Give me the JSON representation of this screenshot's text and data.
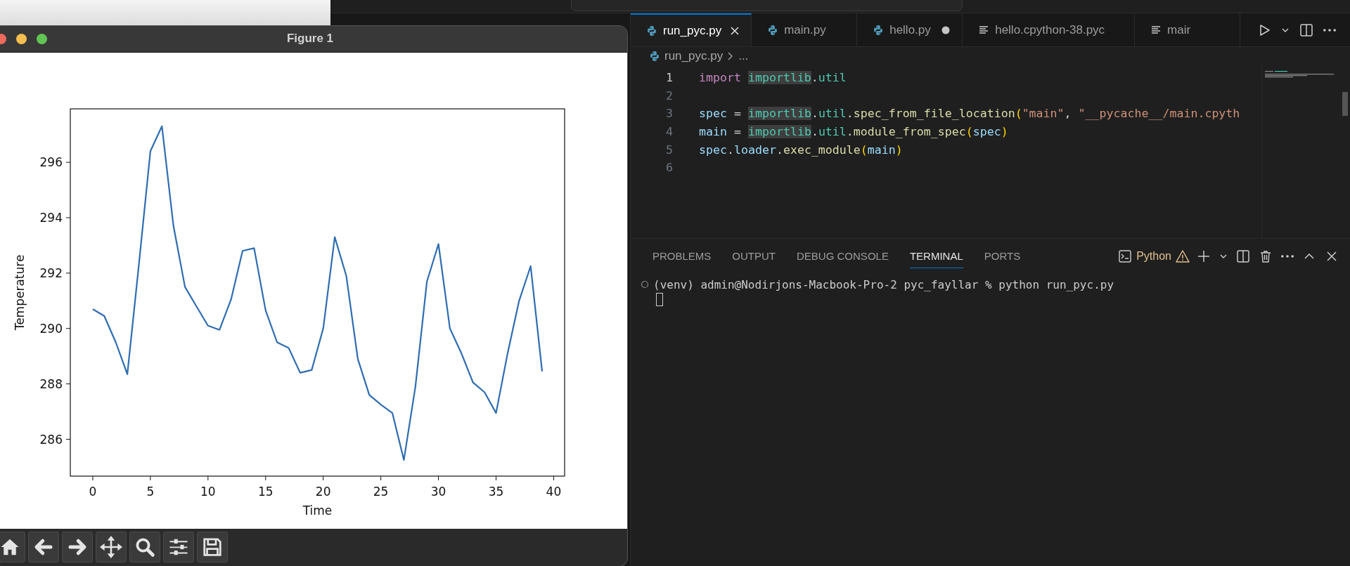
{
  "figure_window": {
    "title": "Figure 1",
    "chart_data": {
      "type": "line",
      "xlabel": "Time",
      "ylabel": "Temperature",
      "x": [
        0,
        1,
        2,
        3,
        4,
        5,
        6,
        7,
        8,
        9,
        10,
        11,
        12,
        13,
        14,
        15,
        16,
        17,
        18,
        19,
        20,
        21,
        22,
        23,
        24,
        25,
        26,
        27,
        28,
        29,
        30,
        31,
        32,
        33,
        34,
        35,
        36,
        37,
        38,
        39
      ],
      "series": [
        {
          "color": "#2f6db0",
          "values": [
            290.7,
            290.45,
            289.5,
            288.35,
            292.3,
            296.4,
            297.3,
            293.7,
            291.5,
            290.8,
            290.1,
            289.95,
            291.05,
            292.8,
            292.9,
            290.65,
            289.5,
            289.3,
            288.4,
            288.5,
            290.0,
            293.3,
            291.9,
            288.9,
            287.6,
            287.25,
            286.95,
            285.25,
            287.9,
            291.7,
            293.05,
            290.0,
            289.1,
            288.05,
            287.7,
            286.95,
            289.1,
            291.0,
            292.25,
            288.45
          ]
        }
      ],
      "xlim": [
        -1.95,
        40.95
      ],
      "ylim": [
        284.67,
        297.93
      ],
      "xticks": [
        0,
        5,
        10,
        15,
        20,
        25,
        30,
        35,
        40
      ],
      "yticks": [
        286,
        288,
        290,
        292,
        294,
        296
      ]
    }
  },
  "editor": {
    "tabs": [
      {
        "label": "run_pyc.py",
        "kind": "python",
        "selected": true,
        "modified": false
      },
      {
        "label": "main.py",
        "kind": "python",
        "selected": false,
        "modified": false
      },
      {
        "label": "hello.py",
        "kind": "python",
        "selected": false,
        "modified": true
      },
      {
        "label": "hello.cpython-38.pyc",
        "kind": "binary",
        "selected": false,
        "modified": false
      },
      {
        "label": "mair",
        "kind": "binary",
        "selected": false,
        "modified": false
      }
    ],
    "breadcrumb": [
      "run_pyc.py",
      "..."
    ],
    "lines": [
      {
        "number": "1",
        "current": true,
        "tokens": [
          {
            "text": "import ",
            "kind": "keyword"
          },
          {
            "text": "importlib",
            "kind": "match"
          },
          {
            "text": ".",
            "kind": "op"
          },
          {
            "text": "util",
            "kind": "module"
          }
        ]
      },
      {
        "number": "2",
        "current": false
      },
      {
        "number": "3",
        "current": false,
        "tokens": [
          {
            "text": "spec",
            "kind": "var"
          },
          {
            "text": " = ",
            "kind": "op"
          },
          {
            "text": "importlib",
            "kind": "match"
          },
          {
            "text": ".",
            "kind": "op"
          },
          {
            "text": "util",
            "kind": "module"
          },
          {
            "text": ".",
            "kind": "op"
          },
          {
            "text": "spec_from_file_location",
            "kind": "func"
          },
          {
            "text": "(",
            "kind": "bracket"
          },
          {
            "text": "\"main\"",
            "kind": "string"
          },
          {
            "text": ", ",
            "kind": "op"
          },
          {
            "text": "\"__pycache__/main.cpyth",
            "kind": "string"
          }
        ]
      },
      {
        "number": "4",
        "current": false,
        "tokens": [
          {
            "text": "main",
            "kind": "var"
          },
          {
            "text": " = ",
            "kind": "op"
          },
          {
            "text": "importlib",
            "kind": "match"
          },
          {
            "text": ".",
            "kind": "op"
          },
          {
            "text": "util",
            "kind": "module"
          },
          {
            "text": ".",
            "kind": "op"
          },
          {
            "text": "module_from_spec",
            "kind": "func"
          },
          {
            "text": "(",
            "kind": "bracket"
          },
          {
            "text": "spec",
            "kind": "var"
          },
          {
            "text": ")",
            "kind": "bracket"
          }
        ]
      },
      {
        "number": "5",
        "current": false,
        "tokens": [
          {
            "text": "spec",
            "kind": "var"
          },
          {
            "text": ".",
            "kind": "op"
          },
          {
            "text": "loader",
            "kind": "var"
          },
          {
            "text": ".",
            "kind": "op"
          },
          {
            "text": "exec_module",
            "kind": "func"
          },
          {
            "text": "(",
            "kind": "bracket"
          },
          {
            "text": "main",
            "kind": "var"
          },
          {
            "text": ")",
            "kind": "bracket"
          }
        ]
      },
      {
        "number": "6",
        "current": false
      }
    ]
  },
  "panel": {
    "tabs": [
      {
        "label": "PROBLEMS",
        "selected": false
      },
      {
        "label": "OUTPUT",
        "selected": false
      },
      {
        "label": "DEBUG CONSOLE",
        "selected": false
      },
      {
        "label": "TERMINAL",
        "selected": true
      },
      {
        "label": "PORTS",
        "selected": false
      }
    ],
    "terminal_profile": "Python",
    "terminal_lines": [
      "(venv) admin@Nodirjons-Macbook-Pro-2 pyc_fayllar % python run_pyc.py"
    ]
  }
}
